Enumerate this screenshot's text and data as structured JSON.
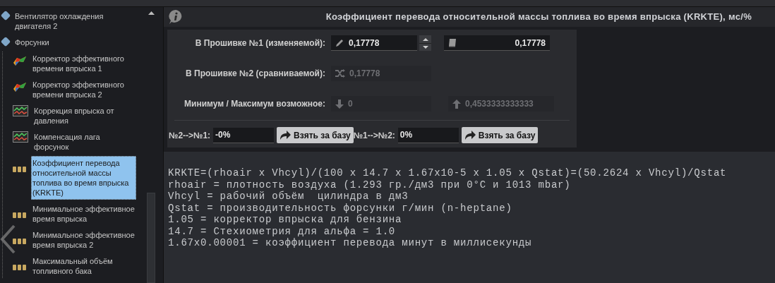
{
  "tree": {
    "items": [
      {
        "kind": "folder",
        "label": "Вентилятор охлаждения двигателя 2",
        "selected": false
      },
      {
        "kind": "folder",
        "label": "Форсунки",
        "selected": false,
        "children": [
          {
            "kind": "map",
            "label": "Корректор эффективного времени впрыска 1",
            "selected": false
          },
          {
            "kind": "map",
            "label": "Корректор эффективного времени впрыска 2",
            "selected": false
          },
          {
            "kind": "chart",
            "label": "Коррекция впрыска от давления",
            "selected": false
          },
          {
            "kind": "chart",
            "label": "Компенсация лага форсунок",
            "selected": false
          },
          {
            "kind": "constant",
            "label": "Коэффициент перевода относительной массы топлива во время впрыска (KRKTE)",
            "selected": true
          },
          {
            "kind": "constant",
            "label": "Минимальное эффективное время впрыска",
            "selected": false
          },
          {
            "kind": "constant",
            "label": "Минимальное эффективное время впрыска 2",
            "selected": false
          },
          {
            "kind": "constant",
            "label": "Максимальный объём топливного бака",
            "selected": false
          }
        ]
      }
    ]
  },
  "header": {
    "title": "Коэффициент перевода относительной массы топлива во время впрыска (KRKTE), мс/%"
  },
  "form": {
    "firmware1": {
      "label": "В Прошивке №1 (изменяемой):",
      "value": "0,17778",
      "original": "0,17778"
    },
    "firmware2": {
      "label": "В Прошивке №2 (сравниваемой):",
      "value": "0,17778",
      "disabled": true
    },
    "limits": {
      "label": "Минимум / Максимум возможное:",
      "min": "0",
      "max": "0,4533333333333",
      "disabled": true
    },
    "conversions": [
      {
        "label": "№2-->№1:",
        "value": "-0%",
        "button": "Взять за базу"
      },
      {
        "label": "№1-->№2:",
        "value": "0%",
        "button": "Взять за базу"
      }
    ]
  },
  "description": {
    "lines": [
      "KRKTE=(rhoair x Vhcyl)/(100 x 14.7 x 1.67x10-5 x 1.05 x Qstat)=(50.2624 x Vhcyl)/Qstat",
      "rhoair = плотность воздуха (1.293 гр./дм3 при 0°C и 1013 mbar)",
      "Vhcyl = рабочий объём  цилиндра в дм3",
      "Qstat = производительность форсунки г/мин (n-heptane)",
      "1.05 = корректор впрыска для бензина",
      "14.7 = Стехиометрия для альфа = 1.0",
      "1.67x0.00001 = коэффициент перевода минут в миллисекунды"
    ]
  }
}
